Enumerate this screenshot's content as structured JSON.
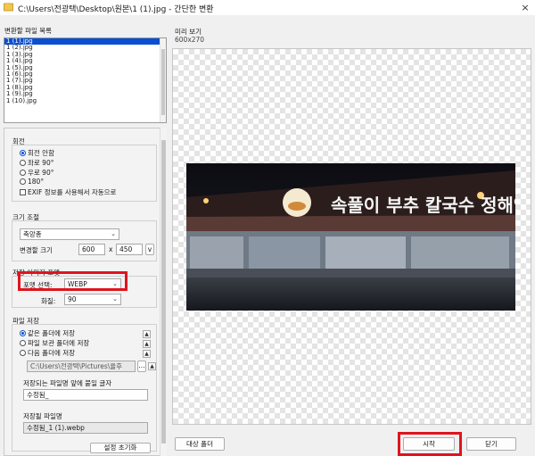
{
  "window": {
    "title": "C:\\Users\\전광택\\Desktop\\원본\\1 (1).jpg - 간단한 변환",
    "close": "×"
  },
  "file_list": {
    "header": "변환할 파일 목록",
    "items": [
      "1 (1).jpg",
      "1 (2).jpg",
      "1 (3).jpg",
      "1 (4).jpg",
      "1 (5).jpg",
      "1 (6).jpg",
      "1 (7).jpg",
      "1 (8).jpg",
      "1 (9).jpg",
      "1 (10).jpg"
    ]
  },
  "rotation": {
    "header": "회전",
    "options": [
      "회전 안함",
      "좌로 90°",
      "우로 90°",
      "180°"
    ],
    "selected": "회전 안함",
    "exif_label": "EXIF 정보를 사용해서 자동으로"
  },
  "resize": {
    "header": "크기 조절",
    "mode_value": "축앙총",
    "size_label": "변경할 크기",
    "width": "600",
    "separator": "x",
    "height": "450",
    "v_button": "v"
  },
  "format": {
    "header": "저장 이미지 포맷",
    "format_label": "포맷 선택:",
    "format_value": "WEBP",
    "quality_label": "화질:",
    "quality_value": "90"
  },
  "save": {
    "header": "파일 저장",
    "options": [
      "같은 폴더에 저장",
      "파일 보관 폴더에 저장",
      "다음 폴더에 저장"
    ],
    "selected": "같은 폴더에 저장",
    "path": "C:\\Users\\전광택\\Pictures\\율후",
    "browse": "...",
    "prefix_label": "저장되는 파일명 앞에 붙일 글자",
    "prefix_value": "수정됨_",
    "filename_label": "저장될 파일명",
    "filename_value": "수정됨_1 (1).webp"
  },
  "preview": {
    "header": "미리 보기",
    "size": "600x270",
    "signboard": "속풀이 부추 칼국수 정해역사"
  },
  "buttons": {
    "reset": "설정 초기화",
    "target_folder": "대상 폴더",
    "start": "시작",
    "close": "닫기"
  },
  "colors": {
    "highlight": "#e0141e",
    "selection": "#0a4fd0"
  }
}
